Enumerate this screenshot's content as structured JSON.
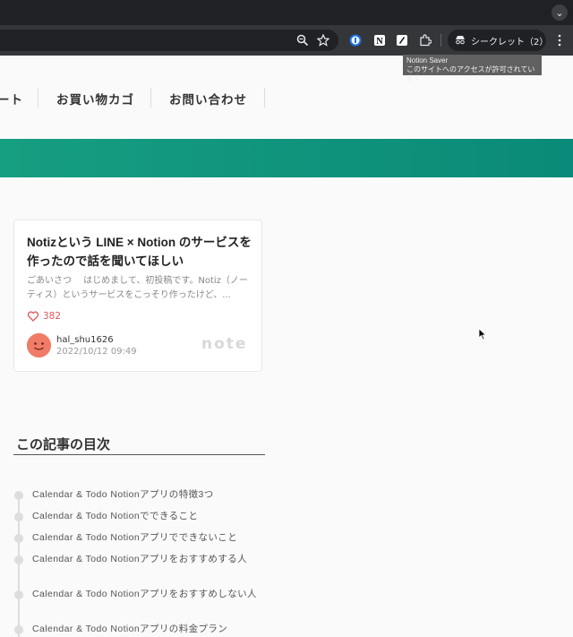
{
  "browser": {
    "incognito_label": "シークレット（2）",
    "icons": [
      "zoom-icon",
      "bookmark-star-icon",
      "password-manager-extension-icon",
      "notion-extension-icon",
      "notion-saver-extension-icon",
      "extensions-puzzle-icon",
      "incognito-icon",
      "kebab-menu-icon",
      "tab-search-chevron-icon"
    ],
    "tooltip": {
      "title": "Notion Saver",
      "body": "このサイトへのアクセスが許可されています"
    }
  },
  "nav": {
    "partial_item": "ート",
    "cart": "お買い物カゴ",
    "contact": "お問い合わせ"
  },
  "colors": {
    "banner": "#169e81",
    "likes": "#e0565b",
    "avatar": "#f07c67"
  },
  "card": {
    "title": "Notizという LINE × Notion のサービスを作ったので話を聞いてほしい",
    "excerpt": "ごあいさつ　 はじめまして、初投稿です。Notiz（ノーティス）というサービスをこっそり作ったけど、...",
    "likes": "382",
    "author": "hal_shu1626",
    "date": "2022/10/12 09:49",
    "logo": "note"
  },
  "toc": {
    "heading": "この記事の目次",
    "items": [
      "Calendar & Todo Notionアプリの特徴3つ",
      "Calendar & Todo Notionでできること",
      "Calendar & Todo Notionアプリでできないこと",
      "Calendar & Todo Notionアプリをおすすめする人",
      "Calendar & Todo Notionアプリをおすすめしない人",
      "Calendar & Todo Notionアプリの料金プラン"
    ]
  }
}
